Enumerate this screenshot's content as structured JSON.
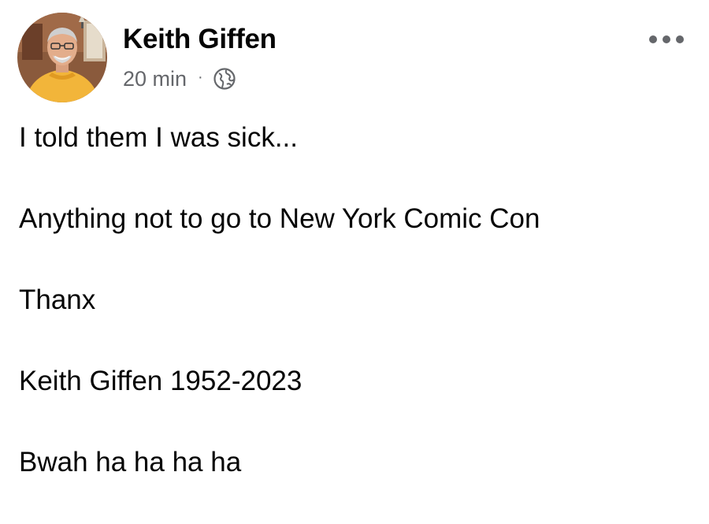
{
  "author": {
    "name": "Keith Giffen",
    "avatar_icon": "profile-photo"
  },
  "meta": {
    "time": "20 min",
    "separator": "·",
    "privacy_icon": "globe-icon"
  },
  "more_button_icon": "more-horizontal-icon",
  "post_lines": [
    "I told them I was sick...",
    "Anything not to go to New York Comic Con",
    "Thanx",
    "Keith Giffen 1952-2023",
    "Bwah ha ha ha ha"
  ],
  "colors": {
    "text": "#050505",
    "secondary_text": "#65676b",
    "background": "#ffffff",
    "avatar_shirt": "#f2b53a"
  }
}
